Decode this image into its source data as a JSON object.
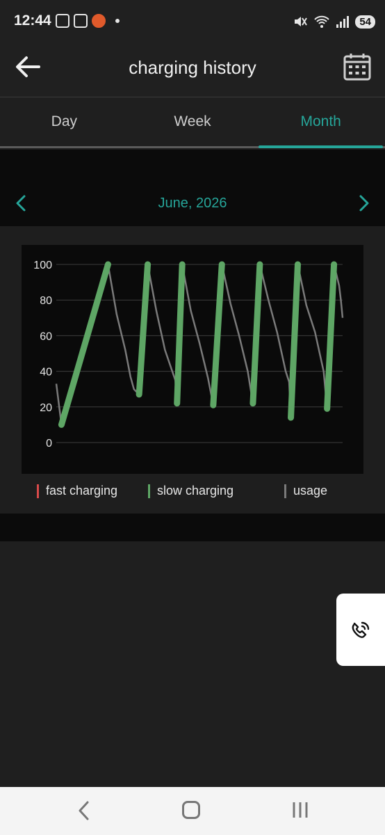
{
  "status_bar": {
    "time": "12:44",
    "battery": "54"
  },
  "app_bar": {
    "title": "charging history"
  },
  "tabs": [
    {
      "label": "Day",
      "active": false
    },
    {
      "label": "Week",
      "active": false
    },
    {
      "label": "Month",
      "active": true
    }
  ],
  "month_nav": {
    "label": "June, 2026"
  },
  "chart_data": {
    "type": "line",
    "ylim": [
      0,
      100
    ],
    "yticks": [
      "100",
      "80",
      "60",
      "40",
      "20",
      "0"
    ],
    "grid": true,
    "legend_position": "bottom",
    "series": [
      {
        "name": "usage",
        "color": "#7a7a7a",
        "points": [
          [
            0.0,
            33
          ],
          [
            3,
            10
          ],
          [
            30,
            100
          ],
          [
            35,
            72
          ],
          [
            40,
            52
          ],
          [
            43,
            37
          ],
          [
            45,
            30
          ],
          [
            48,
            27
          ],
          [
            53,
            100
          ],
          [
            58,
            74
          ],
          [
            63,
            52
          ],
          [
            69,
            35
          ],
          [
            70,
            22
          ],
          [
            73,
            100
          ],
          [
            78,
            74
          ],
          [
            83,
            56
          ],
          [
            88,
            36
          ],
          [
            91,
            21
          ],
          [
            96,
            100
          ],
          [
            101,
            78
          ],
          [
            106,
            60
          ],
          [
            111,
            40
          ],
          [
            114,
            22
          ],
          [
            118,
            100
          ],
          [
            123,
            80
          ],
          [
            128,
            62
          ],
          [
            133,
            40
          ],
          [
            135,
            34
          ],
          [
            136,
            14
          ],
          [
            140,
            100
          ],
          [
            145,
            77
          ],
          [
            150,
            62
          ],
          [
            155,
            40
          ],
          [
            157,
            19
          ],
          [
            161,
            100
          ],
          [
            164,
            88
          ],
          [
            165,
            80
          ],
          [
            166,
            70
          ]
        ]
      },
      {
        "name": "slow charging",
        "color": "#5ea665",
        "segments": [
          [
            [
              3,
              10
            ],
            [
              30,
              100
            ]
          ],
          [
            [
              48,
              27
            ],
            [
              53,
              100
            ]
          ],
          [
            [
              70,
              22
            ],
            [
              73,
              100
            ]
          ],
          [
            [
              91,
              21
            ],
            [
              96,
              100
            ]
          ],
          [
            [
              114,
              22
            ],
            [
              118,
              100
            ]
          ],
          [
            [
              136,
              14
            ],
            [
              140,
              100
            ]
          ],
          [
            [
              157,
              19
            ],
            [
              161,
              100
            ]
          ]
        ]
      },
      {
        "name": "fast charging",
        "color": "#d84a4a",
        "segments": []
      }
    ]
  },
  "legend": [
    {
      "label": "fast charging",
      "color": "#d84a4a"
    },
    {
      "label": "slow charging",
      "color": "#5ea665"
    },
    {
      "label": "usage",
      "color": "#7a7a7a"
    }
  ],
  "colors": {
    "accent": "#26a69a",
    "background": "#1f1f1f",
    "chart_background": "#0a0a0a"
  },
  "icons": {
    "back": "arrow-left-icon",
    "calendar": "calendar-icon",
    "prev": "chevron-left-icon",
    "next": "chevron-right-icon",
    "call": "phone-call-icon"
  }
}
